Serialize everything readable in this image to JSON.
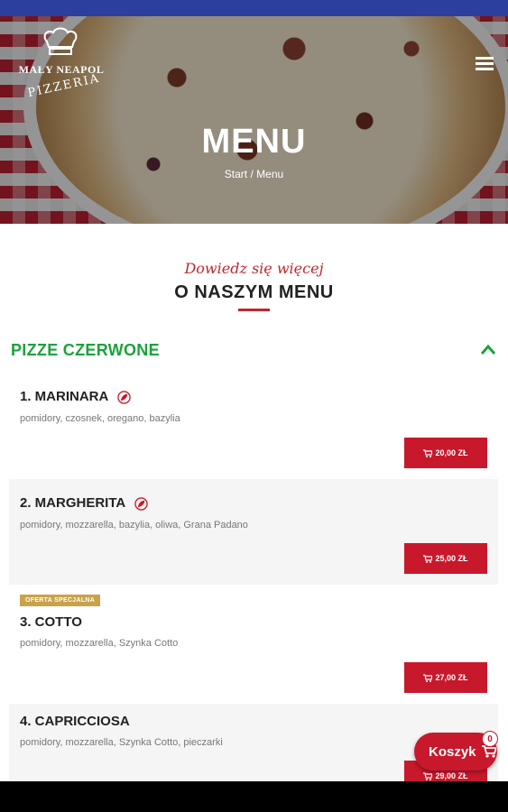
{
  "brand": {
    "name": "MAŁY NEAPOL",
    "subtitle": "PIZZERIA",
    "colors": {
      "accent": "#c8182c",
      "category": "#1aa33b",
      "badge": "#c9a24a",
      "status_bar": "#2c3e9e"
    }
  },
  "hero": {
    "title": "MENU",
    "breadcrumb_start": "Start",
    "breadcrumb_sep": "/",
    "breadcrumb_current": "Menu"
  },
  "intro": {
    "script": "Dowiedz się więcej",
    "title": "O NASZYM MENU"
  },
  "category": {
    "title": "PIZZE CZERWONE",
    "icon": "chevron-up-icon"
  },
  "items": [
    {
      "name": "1. MARINARA",
      "desc": "pomidory, czosnek, oregano, bazylia",
      "price": "20,00 ZŁ",
      "icon": "vegan-leaf-icon"
    },
    {
      "name": "2. MARGHERITA",
      "desc": "pomidory, mozzarella, bazylia, oliwa, Grana Padano",
      "price": "25,00 ZŁ",
      "icon": "vegetarian-icon"
    },
    {
      "name": "3. COTTO",
      "desc": "pomidory, mozzarella, Szynka Cotto",
      "price": "27,00 ZŁ",
      "badge": "OFERTA SPECJALNA"
    },
    {
      "name": "4. CAPRICCIOSA",
      "desc": "pomidory, mozzarella, Szynka Cotto, pieczarki",
      "price": "29,00 ZŁ"
    }
  ],
  "cart": {
    "label": "Koszyk",
    "count": "0",
    "icon": "cart-icon"
  }
}
